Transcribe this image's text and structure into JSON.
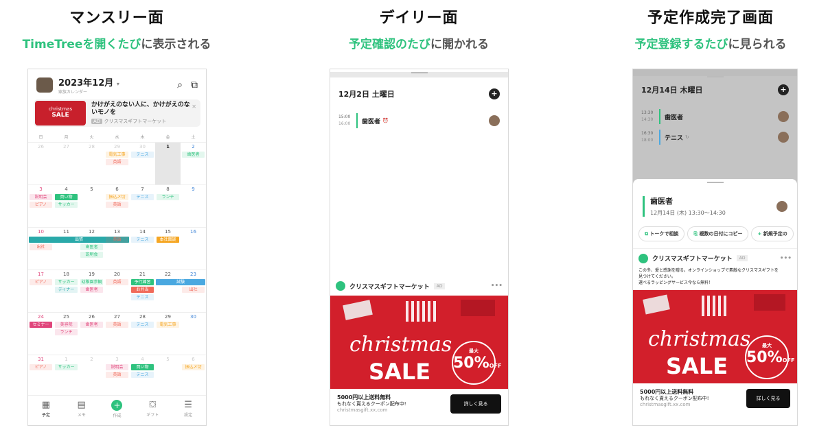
{
  "columns": [
    {
      "title": "マンスリー面",
      "sub_hl": "TimeTreeを開くたび",
      "sub_rest": "に表示される"
    },
    {
      "title": "デイリー面",
      "sub_hl": "予定確認のたび",
      "sub_rest": "に開かれる"
    },
    {
      "title": "予定作成完了画面",
      "sub_hl": "予定登録するたび",
      "sub_rest": "に見られる"
    }
  ],
  "monthly": {
    "month": "2023年12月",
    "caret": "▾",
    "calendar_name": "家族カレンダー",
    "ad": {
      "img_line1": "christmas",
      "img_line2": "SALE",
      "text": "かけがえのない人に、かけがえのないモノを",
      "tag": "AD",
      "sponsor": "クリスマスギフトマーケット"
    },
    "weekdays": [
      "日",
      "月",
      "火",
      "水",
      "木",
      "金",
      "土"
    ],
    "weeks": [
      {
        "days": [
          "26",
          "27",
          "28",
          "29",
          "30",
          "1",
          "2"
        ],
        "events": [
          {
            "col": 3,
            "row": 0,
            "text": "電気工事",
            "color": "#f5a623"
          },
          {
            "col": 3,
            "row": 1,
            "text": "英語",
            "color": "#f06a5a"
          },
          {
            "col": 4,
            "row": 0,
            "text": "テニス",
            "color": "#4aa8e0"
          },
          {
            "col": 6,
            "row": 0,
            "text": "歯医者",
            "color": "#2ec27e"
          }
        ]
      },
      {
        "days": [
          "3",
          "4",
          "5",
          "6",
          "7",
          "8",
          "9"
        ],
        "events": [
          {
            "col": 0,
            "row": 0,
            "text": "説明会",
            "color": "#e0457b"
          },
          {
            "col": 0,
            "row": 1,
            "text": "ピアノ",
            "color": "#f06a5a"
          },
          {
            "col": 1,
            "row": 0,
            "text": "買い物",
            "color": "#2ec27e",
            "solid": true
          },
          {
            "col": 1,
            "row": 1,
            "text": "サッカー",
            "color": "#2ec27e"
          },
          {
            "col": 3,
            "row": 0,
            "text": "振込〆切",
            "color": "#f5a623"
          },
          {
            "col": 3,
            "row": 1,
            "text": "英語",
            "color": "#f06a5a"
          },
          {
            "col": 4,
            "row": 0,
            "text": "テニス",
            "color": "#4aa8e0"
          },
          {
            "col": 5,
            "row": 0,
            "text": "ランチ",
            "color": "#2ec27e"
          }
        ]
      },
      {
        "days": [
          "10",
          "11",
          "12",
          "13",
          "14",
          "15",
          "16"
        ],
        "events": [
          {
            "col": 0,
            "row": 1,
            "text": "出社",
            "color": "#f06a5a"
          },
          {
            "col": 2,
            "row": 1,
            "text": "歯医者",
            "color": "#2ec27e"
          },
          {
            "col": 2,
            "row": 2,
            "text": "説明会",
            "color": "#2ec27e"
          },
          {
            "col": 3,
            "row": 0,
            "text": "英語",
            "color": "#f06a5a"
          },
          {
            "col": 4,
            "row": 0,
            "text": "テニス",
            "color": "#4aa8e0"
          },
          {
            "col": 5,
            "row": 0,
            "text": "本社面談",
            "color": "#f5a623",
            "solid": true
          }
        ],
        "span": {
          "start": 0,
          "end": 3,
          "text": "出張",
          "color": "#2aa9a9"
        }
      },
      {
        "days": [
          "17",
          "18",
          "19",
          "20",
          "21",
          "22",
          "23"
        ],
        "events": [
          {
            "col": 0,
            "row": 0,
            "text": "ピアノ",
            "color": "#f06a5a"
          },
          {
            "col": 1,
            "row": 0,
            "text": "サッカー",
            "color": "#2ec27e"
          },
          {
            "col": 1,
            "row": 1,
            "text": "ディナー",
            "color": "#2aa9a9"
          },
          {
            "col": 2,
            "row": 0,
            "text": "幼稚園参観",
            "color": "#2ec27e"
          },
          {
            "col": 2,
            "row": 1,
            "text": "歯医者",
            "color": "#e0457b"
          },
          {
            "col": 3,
            "row": 0,
            "text": "英語",
            "color": "#f06a5a"
          },
          {
            "col": 4,
            "row": 0,
            "text": "予行練習",
            "color": "#2ec27e",
            "solid": true
          },
          {
            "col": 4,
            "row": 1,
            "text": "お弁当",
            "color": "#f06a5a",
            "solid": true
          },
          {
            "col": 4,
            "row": 2,
            "text": "テニス",
            "color": "#4aa8e0"
          },
          {
            "col": 6,
            "row": 1,
            "text": "出社",
            "color": "#f06a5a"
          }
        ],
        "span": {
          "start": 5,
          "end": 6,
          "text": "試験",
          "color": "#4aa8e0"
        }
      },
      {
        "days": [
          "24",
          "25",
          "26",
          "27",
          "28",
          "29",
          "30"
        ],
        "events": [
          {
            "col": 0,
            "row": 0,
            "text": "セミナー",
            "color": "#e0457b",
            "solid": true
          },
          {
            "col": 1,
            "row": 0,
            "text": "美容院",
            "color": "#e0457b"
          },
          {
            "col": 1,
            "row": 1,
            "text": "ランチ",
            "color": "#e0457b"
          },
          {
            "col": 2,
            "row": 0,
            "text": "歯医者",
            "color": "#e0457b"
          },
          {
            "col": 3,
            "row": 0,
            "text": "英語",
            "color": "#f06a5a"
          },
          {
            "col": 4,
            "row": 0,
            "text": "テニス",
            "color": "#4aa8e0"
          },
          {
            "col": 5,
            "row": 0,
            "text": "電気工事",
            "color": "#f5a623"
          }
        ]
      },
      {
        "days": [
          "31",
          "1",
          "2",
          "3",
          "4",
          "5",
          "6"
        ],
        "events": [
          {
            "col": 0,
            "row": 0,
            "text": "ピアノ",
            "color": "#f06a5a"
          },
          {
            "col": 1,
            "row": 0,
            "text": "サッカー",
            "color": "#2ec27e"
          },
          {
            "col": 3,
            "row": 0,
            "text": "説明会",
            "color": "#e0457b"
          },
          {
            "col": 3,
            "row": 1,
            "text": "英語",
            "color": "#f06a5a"
          },
          {
            "col": 4,
            "row": 0,
            "text": "買い物",
            "color": "#2ec27e",
            "solid": true
          },
          {
            "col": 4,
            "row": 1,
            "text": "テニス",
            "color": "#4aa8e0"
          },
          {
            "col": 6,
            "row": 0,
            "text": "振込〆切",
            "color": "#f5a623"
          }
        ]
      }
    ],
    "tabs": [
      {
        "label": "予定",
        "icon": "▦",
        "active": true
      },
      {
        "label": "メモ",
        "icon": "▤"
      },
      {
        "label": "作成",
        "icon": "+",
        "create": true
      },
      {
        "label": "ギフト",
        "icon": "⛋"
      },
      {
        "label": "設定",
        "icon": "☰"
      }
    ]
  },
  "daily": {
    "date": "12月2日 土曜日",
    "plus": "+",
    "event": {
      "start": "15:00",
      "end": "16:00",
      "name": "歯医者",
      "icon": "⏰"
    },
    "ad": {
      "sponsor": "クリスマスギフトマーケット",
      "tag": "AD",
      "dots": "•••"
    },
    "banner": {
      "xmas": "christmas",
      "sale": "SALE",
      "badge_top": "最大",
      "badge_num": "50%",
      "badge_off": "OFF"
    },
    "foot": {
      "line1": "5000円以上送料無料",
      "line2": "もれなく貰えるクーポン配布中!",
      "url": "christmasgift.xx.com",
      "button": "詳しく見る"
    }
  },
  "complete": {
    "date": "12月14日 木曜日",
    "plus": "+",
    "events": [
      {
        "start": "13:30",
        "end": "14:30",
        "name": "歯医者",
        "icon": ""
      },
      {
        "start": "16:30",
        "end": "18:00",
        "name": "テニス",
        "icon": "↻"
      }
    ],
    "detail": {
      "title": "歯医者",
      "time": "12月14日 (木) 13:30〜14:30"
    },
    "actions": [
      {
        "icon": "⧉",
        "label": "トークで相談"
      },
      {
        "icon": "⎘",
        "label": "複数の日付にコピー"
      },
      {
        "icon": "+",
        "label": "新規予定の"
      }
    ],
    "ad": {
      "sponsor": "クリスマスギフトマーケット",
      "tag": "AD",
      "dots": "•••",
      "body1": "この冬、愛と感謝を贈る。オンラインショップで素敵なクリスマスギフトを",
      "body2": "見つけてください。",
      "body3": "選べるラッピングサービス今なら無料！"
    },
    "banner": {
      "xmas": "christmas",
      "sale": "SALE",
      "badge_top": "最大",
      "badge_num": "50%",
      "badge_off": "OFF"
    },
    "foot": {
      "line1": "5000円以上送料無料",
      "line2": "もれなく貰えるクーポン配布中!",
      "url": "christmasgift.xx.com",
      "button": "詳しく見る"
    }
  }
}
